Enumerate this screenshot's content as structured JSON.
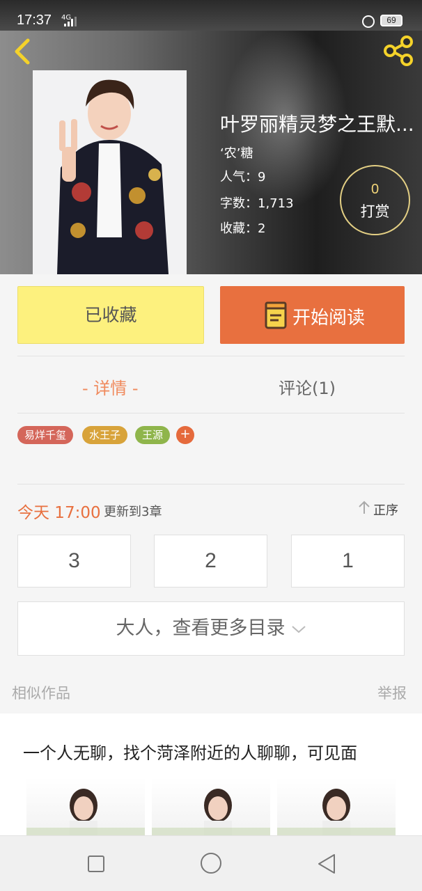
{
  "status_bar": {
    "time": "17:37",
    "network": "4G",
    "battery": "69"
  },
  "book": {
    "title": "叶罗丽精灵梦之王默...",
    "author": "‘农’糖",
    "stats": [
      {
        "label": "人气：",
        "value": "9"
      },
      {
        "label": "字数：",
        "value": "1,713"
      },
      {
        "label": "收藏：",
        "value": "2"
      }
    ],
    "tip": {
      "count": "0",
      "label": "打赏"
    }
  },
  "actions": {
    "favorite_label": "已收藏",
    "read_label": "开始阅读"
  },
  "tabs": {
    "detail": "- 详情 -",
    "comments": "评论(1)"
  },
  "tags": [
    {
      "label": "易烊千玺",
      "color": "#d4665a"
    },
    {
      "label": "水王子",
      "color": "#d8a33a"
    },
    {
      "label": "王源",
      "color": "#8fb54b"
    }
  ],
  "tag_add": "+",
  "update": {
    "time": "今天 17:00",
    "text": "更新到3章",
    "sort_label": "正序"
  },
  "chapters": [
    "3",
    "2",
    "1"
  ],
  "more_toc": "大人，查看更多目录",
  "similar": {
    "title": "相似作品",
    "report": "举报"
  },
  "ad": {
    "title": "一个人无聊，找个菏泽附近的人聊聊，可见面"
  },
  "colors": {
    "accent": "#e8703f",
    "favorite_bg": "#fdf17e",
    "tip_ring": "#e3cf84"
  }
}
